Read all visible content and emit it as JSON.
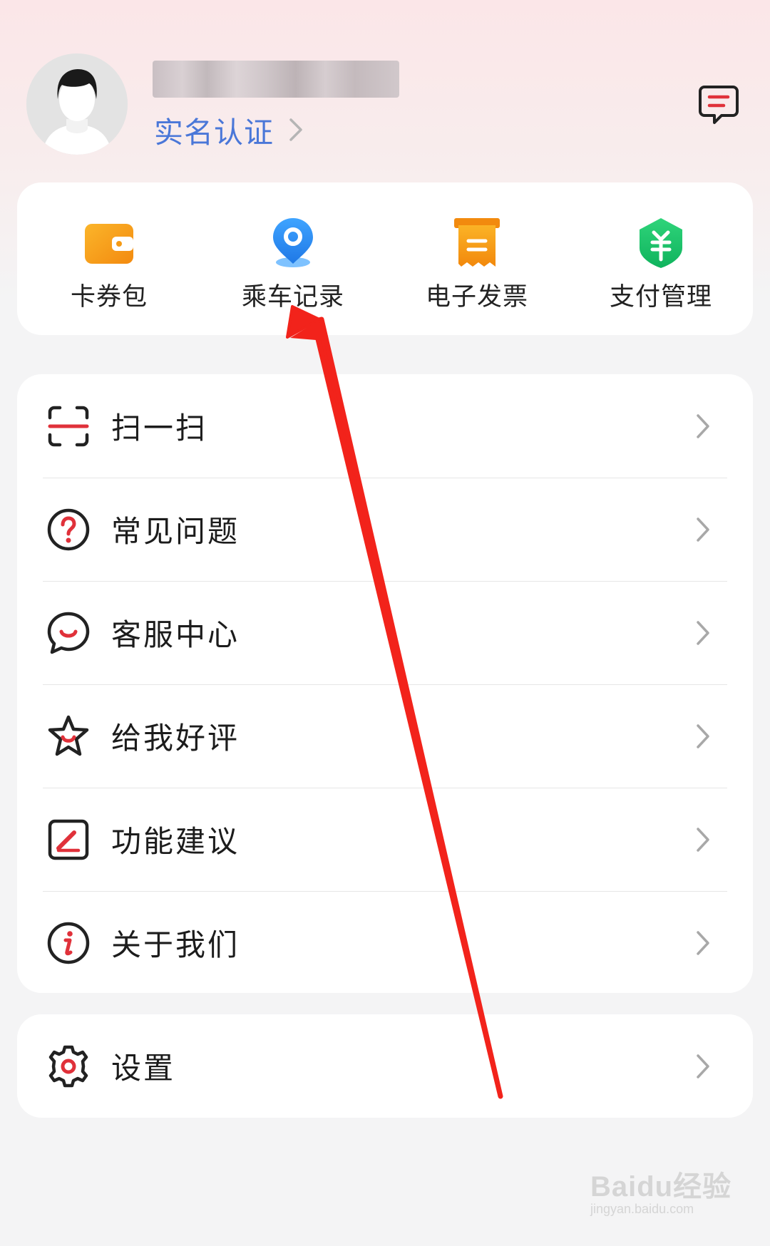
{
  "header": {
    "verify_label": "实名认证"
  },
  "quick_actions": [
    {
      "label": "卡券包",
      "icon": "wallet-icon"
    },
    {
      "label": "乘车记录",
      "icon": "location-pin-icon"
    },
    {
      "label": "电子发票",
      "icon": "invoice-icon"
    },
    {
      "label": "支付管理",
      "icon": "payment-shield-icon"
    }
  ],
  "menu": [
    {
      "label": "扫一扫",
      "icon": "scan-icon"
    },
    {
      "label": "常见问题",
      "icon": "question-icon"
    },
    {
      "label": "客服中心",
      "icon": "customer-service-icon"
    },
    {
      "label": "给我好评",
      "icon": "star-icon"
    },
    {
      "label": "功能建议",
      "icon": "edit-icon"
    },
    {
      "label": "关于我们",
      "icon": "info-icon"
    }
  ],
  "settings": {
    "label": "设置",
    "icon": "gear-icon"
  },
  "watermark": {
    "main": "Baidu经验",
    "sub": "jingyan.baidu.com"
  },
  "colors": {
    "accent_red": "#e0313a",
    "verify_blue": "#4a77d8",
    "wallet_orange": "#f7a21b",
    "pin_blue": "#2f8ff0",
    "invoice_orange": "#f39a10",
    "pay_green": "#16c46b",
    "annotation_red": "#f2231b"
  }
}
